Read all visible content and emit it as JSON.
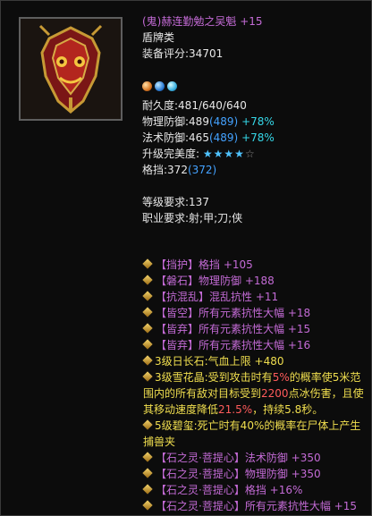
{
  "item": {
    "title": "(鬼)赫连勤勉之吴魁",
    "enhance": "+15",
    "type": "盾牌类",
    "score_label": "装备评分:",
    "score": "34701",
    "gem_icons": [
      "fire-gem-icon",
      "water-gem-icon",
      "ice-gem-icon"
    ]
  },
  "stats": {
    "durability": "耐久度:481/640/640",
    "phys_def_label": "物理防御:489",
    "phys_def_bonus": "(489)",
    "phys_def_pct": "+78%",
    "magic_def_label": "法术防御:465",
    "magic_def_bonus": "(489)",
    "magic_def_pct": "+78%",
    "perfect_label": "升级完美度:",
    "perfect_stars": 4,
    "perfect_max": 5,
    "block_label": "格挡:372",
    "block_bonus": "(372)"
  },
  "requirements": {
    "level": "等级要求:137",
    "class": "职业要求:射;甲;刀;侠"
  },
  "affixes": [
    {
      "text": "【挡护】格挡",
      "bonus": "+105"
    },
    {
      "text": "【磐石】物理防御",
      "bonus": "+188"
    },
    {
      "text": "【抗混乱】混乱抗性",
      "bonus": "+11"
    },
    {
      "text": "【皆空】所有元素抗性大幅",
      "bonus": "+18"
    },
    {
      "text": "【皆弃】所有元素抗性大幅",
      "bonus": "+15"
    },
    {
      "text": "【皆弃】所有元素抗性大幅",
      "bonus": "+16"
    }
  ],
  "gems": [
    {
      "text": "3级日长石:气血上限",
      "bonus": "+480"
    },
    {
      "text_a": "3级雪花晶:受到攻击时有",
      "red_a": "5%",
      "text_b": "的概率使5米范围内的所有敌对目标受到",
      "red_b": "2200",
      "text_c": "点冰伤害，且使其移动速度降低",
      "red_c": "21.5%",
      "text_d": "，持续5.8秒。"
    },
    {
      "text_a": "5级碧玺:死亡时有40%的概率在尸体上产生捕兽夹"
    }
  ],
  "spirit": [
    {
      "text": "【石之灵·菩提心】法术防御",
      "bonus": "+350"
    },
    {
      "text": "【石之灵·菩提心】物理防御",
      "bonus": "+350"
    },
    {
      "text": "【石之灵·菩提心】格挡",
      "bonus": "+16%"
    },
    {
      "text": "【石之灵·菩提心】所有元素抗性大幅",
      "bonus": "+15"
    }
  ],
  "colors": {
    "title": "#c46bd6",
    "bonus_blue": "#44a2ff",
    "pct_cyan": "#35d7e8",
    "gem_yellow": "#f1df4f",
    "gem_red": "#ff5b5b"
  }
}
